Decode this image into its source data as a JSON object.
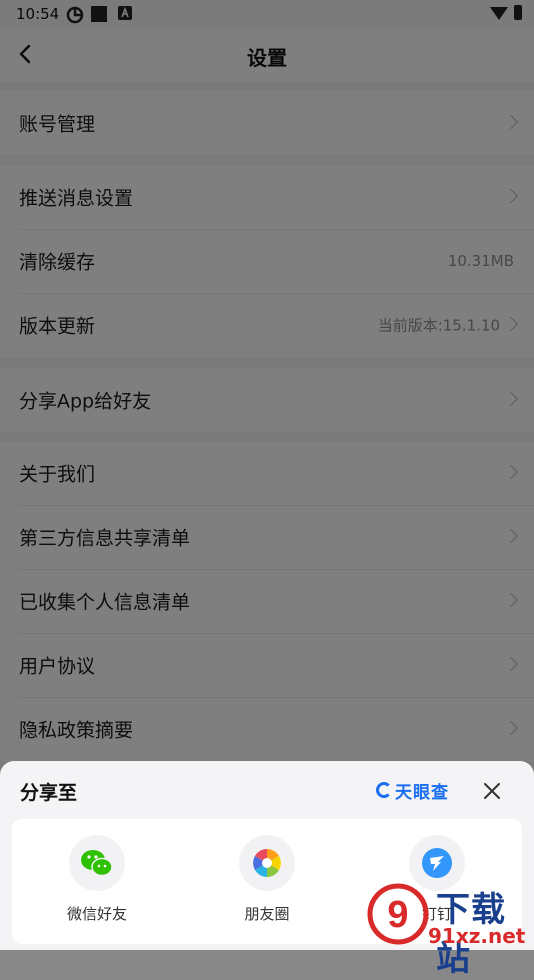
{
  "status_bar": {
    "time": "10:54"
  },
  "nav": {
    "title": "设置"
  },
  "groups": [
    [
      {
        "label": "账号管理",
        "value": "",
        "arrow": true
      }
    ],
    [
      {
        "label": "推送消息设置",
        "value": "",
        "arrow": true
      },
      {
        "label": "清除缓存",
        "value": "10.31MB",
        "arrow": false
      },
      {
        "label": "版本更新",
        "value": "当前版本:15.1.10",
        "arrow": true
      }
    ],
    [
      {
        "label": "分享App给好友",
        "value": "",
        "arrow": true
      }
    ],
    [
      {
        "label": "关于我们",
        "value": "",
        "arrow": true
      },
      {
        "label": "第三方信息共享清单",
        "value": "",
        "arrow": true
      },
      {
        "label": "已收集个人信息清单",
        "value": "",
        "arrow": true
      },
      {
        "label": "用户协议",
        "value": "",
        "arrow": true
      },
      {
        "label": "隐私政策摘要",
        "value": "",
        "arrow": true
      }
    ]
  ],
  "share_sheet": {
    "title": "分享至",
    "brand": "天眼查",
    "targets": [
      {
        "label": "微信好友",
        "icon": "wechat-icon",
        "color": "#2dc100"
      },
      {
        "label": "朋友圈",
        "icon": "moments-icon",
        "color": "#ff9f1a"
      },
      {
        "label": "钉钉",
        "icon": "dingtalk-icon",
        "color": "#3296fa"
      }
    ]
  },
  "watermark": {
    "text": "下载站",
    "url": "91xz.net",
    "number": "9"
  },
  "colors": {
    "brand_blue": "#1a6ef0",
    "background": "#f5f5f7",
    "overlay": "rgba(0,0,0,0.5)"
  }
}
